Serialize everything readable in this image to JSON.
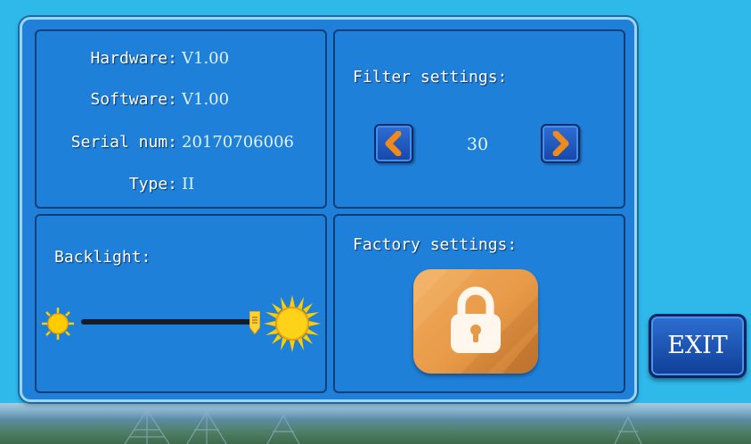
{
  "info": {
    "rows": [
      {
        "label": "Hardware:",
        "value": "V1.00"
      },
      {
        "label": "Software:",
        "value": "V1.00"
      },
      {
        "label": "Serial num:",
        "value": "20170706006"
      },
      {
        "label": "Type:",
        "value": "II"
      }
    ]
  },
  "filter": {
    "title": "Filter settings:",
    "value": "30",
    "decrease_icon": "chevron-left-icon",
    "increase_icon": "chevron-right-icon"
  },
  "backlight": {
    "title": "Backlight:",
    "level_fraction": 1.0,
    "min_icon": "sun-small-icon",
    "max_icon": "sun-large-icon"
  },
  "factory": {
    "title": "Factory settings:",
    "icon": "lock-icon"
  },
  "exit": {
    "label": "EXIT"
  },
  "colors": {
    "background": "#2fb8ea",
    "panel": "#1f80da",
    "panel_border": "#0b3f7a",
    "button_blue": "#1647a8",
    "arrow_orange": "#f08a1c",
    "lock_orange": "#e89a48",
    "sun_yellow": "#ffcc00"
  }
}
